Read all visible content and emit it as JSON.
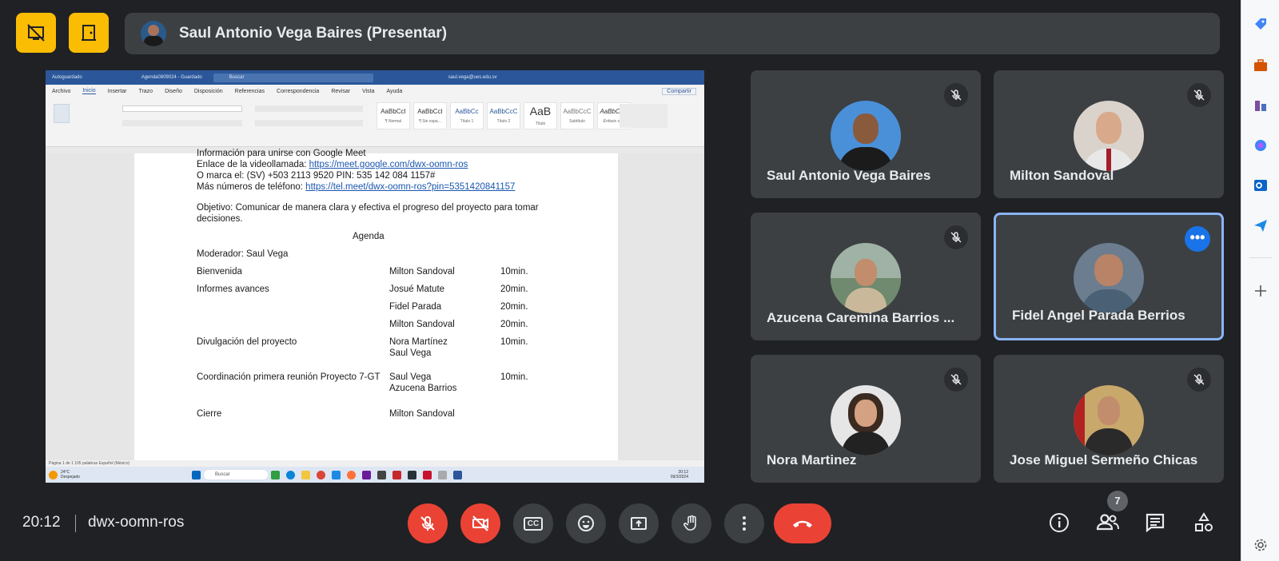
{
  "presenter": {
    "name": "Saul Antonio Vega Baires (Presentar)"
  },
  "screen": {
    "window": {
      "autosave": "Autoguardado",
      "doc_title": "Agenda0809024 - Guardado",
      "search": "Buscar",
      "user": "saul.vega@ues.edu.sv"
    },
    "tabs": [
      "Archivo",
      "Inicio",
      "Insertar",
      "Trazo",
      "Diseño",
      "Disposición",
      "Referencias",
      "Correspondencia",
      "Revisar",
      "Vista",
      "Ayuda"
    ],
    "active_tab": "Inicio",
    "share_label": "Compartir",
    "styles": [
      {
        "preview": "AaBbCcI",
        "label": "¶ Normal"
      },
      {
        "preview": "AaBbCcI",
        "label": "¶ Sin espa..."
      },
      {
        "preview": "AaBbCc",
        "label": "Título 1"
      },
      {
        "preview": "AaBbCcC",
        "label": "Título 2"
      },
      {
        "preview": "AaB",
        "label": "Título"
      },
      {
        "preview": "AaBbCcC",
        "label": "Subtítulo"
      },
      {
        "preview": "AaBbCcD",
        "label": "Énfasis sutil"
      }
    ],
    "doc": {
      "line_top": "Información para unirse con Google Meet",
      "link_label": "Enlace de la videollamada:",
      "link_url": "https://meet.google.com/dwx-oomn-ros",
      "phone_line": "O marca el: (SV) +503 2113 9520 PIN: 535 142 084 1157#",
      "more_label": "Más números de teléfono:",
      "more_url": "https://tel.meet/dwx-oomn-ros?pin=5351420841157",
      "objective_1": "Objetivo: Comunicar de manera clara y efectiva el progreso del proyecto para tomar",
      "objective_2": "decisiones.",
      "heading": "Agenda",
      "moderator": "Moderador: Saul Vega",
      "rows": [
        {
          "item": "Bienvenida",
          "who": "Milton Sandoval",
          "time": "10min."
        },
        {
          "item": "Informes avances",
          "who": "Josué Matute",
          "time": "20min."
        },
        {
          "item": "",
          "who": "Fidel Parada",
          "time": "20min."
        },
        {
          "item": "",
          "who": "Milton Sandoval",
          "time": "20min."
        },
        {
          "item": "Divulgación del proyecto",
          "who": "Nora Martínez",
          "who2": "Saul Vega",
          "time": "10min."
        },
        {
          "item": "Coordinación primera reunión Proyecto 7-GT",
          "who": "Saul Vega",
          "who2": "Azucena Barrios",
          "time": "10min."
        },
        {
          "item": "Cierre",
          "who": "Milton Sandoval",
          "time": ""
        }
      ]
    },
    "status": "Página 1 de 1    105 palabras    Español (México)",
    "taskbar": {
      "weather": "24°C",
      "weather_sub": "Despejado",
      "search": "Buscar",
      "time": "20:12",
      "date": "09/3/2024"
    }
  },
  "participants": [
    {
      "name": "Saul Antonio Vega Baires",
      "muted": true
    },
    {
      "name": "Milton Sandoval",
      "muted": true
    },
    {
      "name": "Azucena Caremina Barrios ...",
      "muted": true
    },
    {
      "name": "Fidel Angel Parada Berrios",
      "muted": false,
      "active": true
    },
    {
      "name": "Nora Martinez",
      "muted": true
    },
    {
      "name": "Jose Miguel Sermeño Chicas",
      "muted": true
    }
  ],
  "bottom": {
    "time": "20:12",
    "meeting_code": "dwx-oomn-ros",
    "people_count": "7",
    "cc_label": "CC"
  },
  "colors": {
    "bg": "#202124",
    "tile": "#3c4043",
    "red": "#ea4335",
    "yellow": "#fbbc04",
    "active": "#8ab4f8"
  }
}
